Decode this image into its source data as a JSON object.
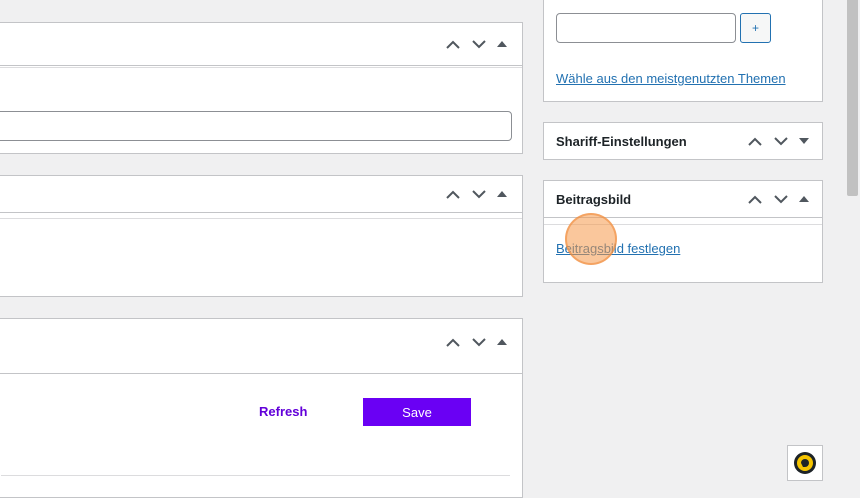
{
  "tags_panel": {
    "add_button_label": "+",
    "most_used_link": "Wähle aus den meistgenutzten Themen"
  },
  "shariff_panel": {
    "title": "Shariff-Einstellungen"
  },
  "featured_image_panel": {
    "title": "Beitragsbild",
    "set_link": "Beitragsbild festlegen"
  },
  "bottom_panel": {
    "refresh_label": "Refresh",
    "save_label": "Save"
  },
  "colors": {
    "link": "#2271b1",
    "refresh": "#6200d9",
    "save_bg": "#6a00f4",
    "cursor_highlight": "#f6994a"
  },
  "icons": [
    "chevron-up-icon",
    "chevron-down-icon",
    "triangle-up-icon",
    "triangle-down-icon",
    "chat-help-icon"
  ]
}
